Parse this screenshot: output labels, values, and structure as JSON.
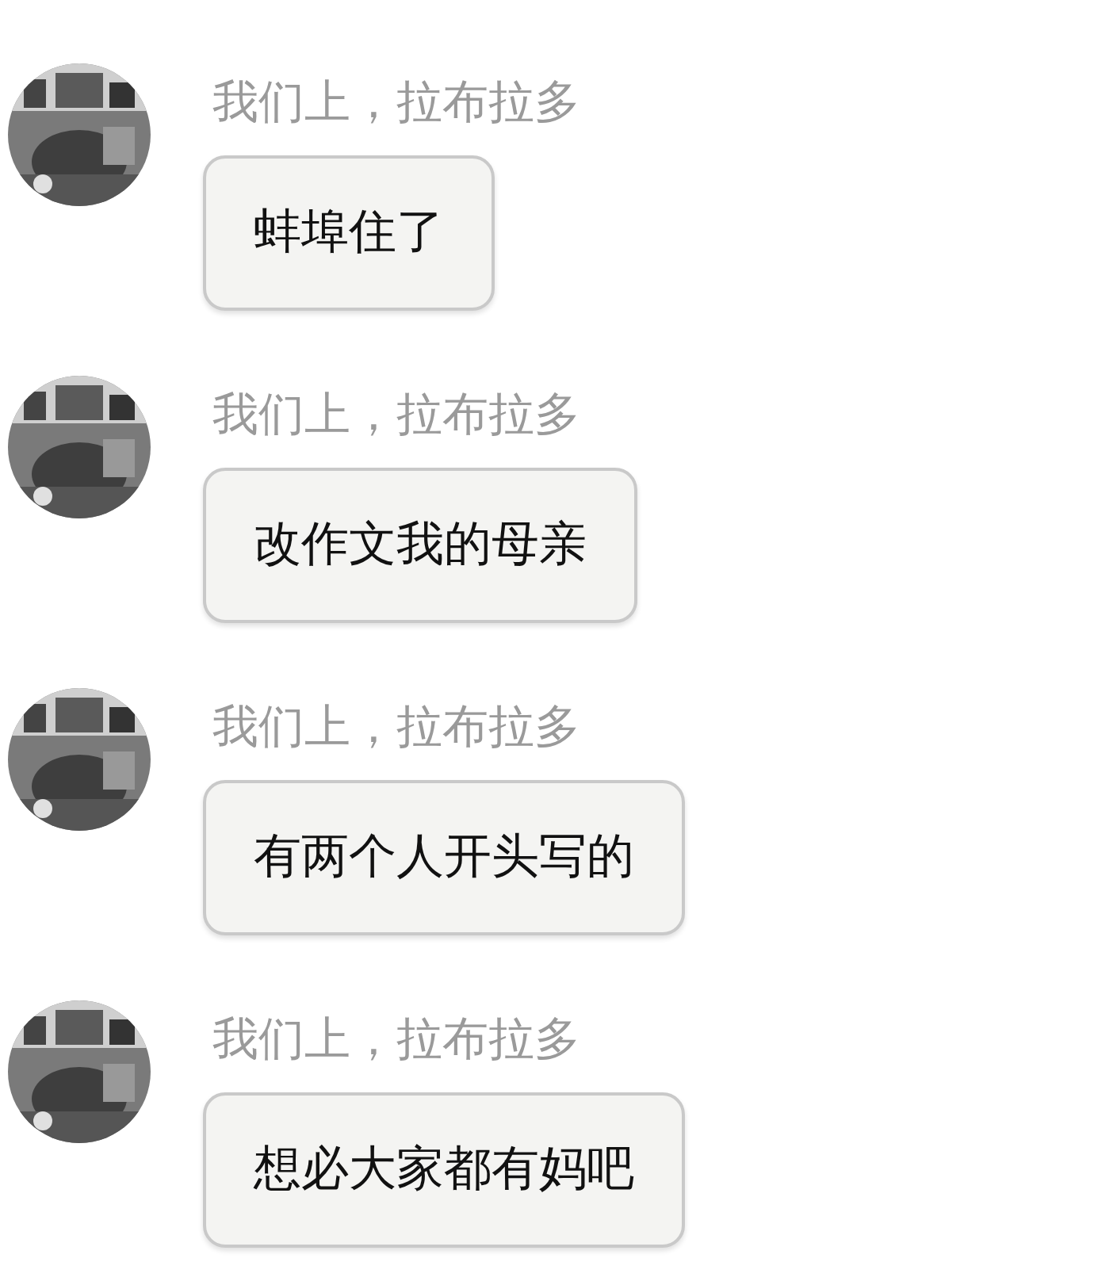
{
  "messages": [
    {
      "sender": "我们上，拉布拉多",
      "text": "蚌埠住了"
    },
    {
      "sender": "我们上，拉布拉多",
      "text": "改作文我的母亲"
    },
    {
      "sender": "我们上，拉布拉多",
      "text": "有两个人开头写的"
    },
    {
      "sender": "我们上，拉布拉多",
      "text": "想必大家都有妈吧"
    }
  ]
}
